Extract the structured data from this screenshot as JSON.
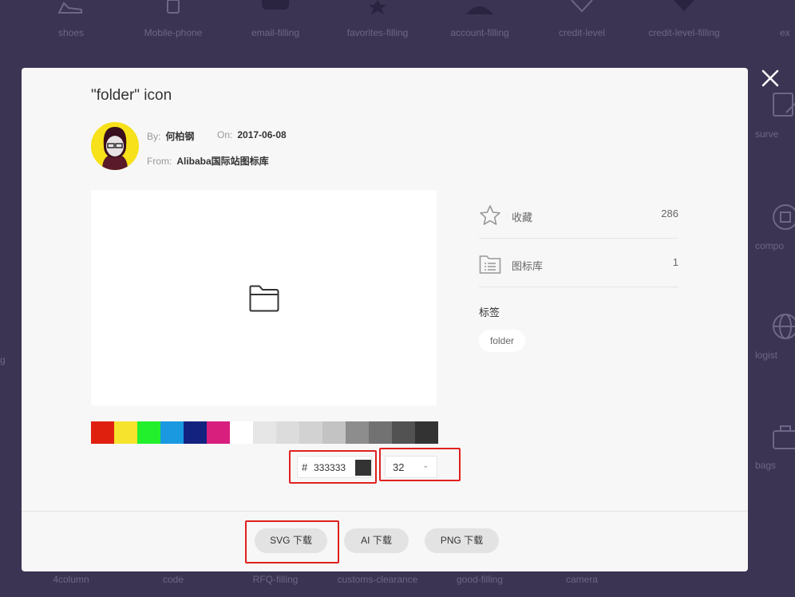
{
  "background": {
    "top_row": [
      {
        "label": "shoes",
        "icon": "shoe-icon"
      },
      {
        "label": "Mobile-phone",
        "icon": "mobile-phone-icon"
      },
      {
        "label": "email-filling",
        "icon": "email-icon"
      },
      {
        "label": "favorites-filling",
        "icon": "star-icon"
      },
      {
        "label": "account-filling",
        "icon": "account-icon"
      },
      {
        "label": "credit-level",
        "icon": "diamond-icon"
      },
      {
        "label": "credit-level-filling",
        "icon": "diamond-filled-icon"
      },
      {
        "label": "ex",
        "icon": "excel-icon"
      }
    ],
    "bottom_row": [
      "4column",
      "code",
      "RFQ-filling",
      "customs-clearance",
      "good-filling",
      "camera"
    ],
    "side_items": [
      "surve",
      "compo",
      "logist",
      "bags"
    ],
    "left_fragment": "g"
  },
  "modal": {
    "title": "\"folder\" icon",
    "author_label": "By:",
    "author": "何柏钢",
    "date_label": "On:",
    "date": "2017-06-08",
    "from_label": "From:",
    "from": "Alibaba国际站图标库",
    "swatches": [
      "#e0200f",
      "#f6e32e",
      "#22f02c",
      "#1a98e0",
      "#14227f",
      "#d81f7e",
      "#ffffff",
      "#e6e6e6",
      "#dcdcdc",
      "#d2d2d2",
      "#c3c3c3",
      "#8d8d8d",
      "#727272",
      "#525252",
      "#333333"
    ],
    "color_hash": "#",
    "color_value": "333333",
    "color_chip": "#333333",
    "size_value": "32",
    "size_arrow": "⌄",
    "stats": [
      {
        "label": "收藏",
        "count": "286",
        "icon": "star-outline-icon"
      },
      {
        "label": "图标库",
        "count": "1",
        "icon": "library-icon"
      }
    ],
    "tags_heading": "标签",
    "tags": [
      "folder"
    ],
    "buttons": {
      "svg": "SVG 下载",
      "ai": "AI 下载",
      "png": "PNG 下载"
    }
  },
  "colors": {
    "overlay_bg": "#3b3453",
    "highlight": "#e02020",
    "icon_color": "#333333"
  }
}
